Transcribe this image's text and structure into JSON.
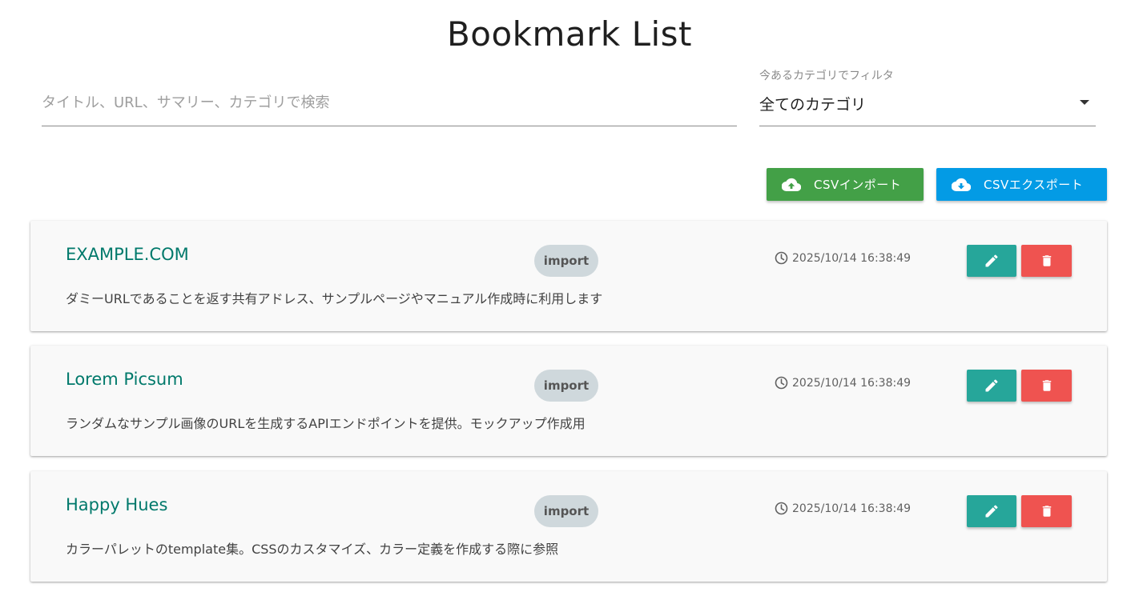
{
  "page": {
    "title": "Bookmark List"
  },
  "search": {
    "placeholder": "タイトル、URL、サマリー、カテゴリで検索",
    "value": ""
  },
  "filter": {
    "label": "今あるカテゴリでフィルタ",
    "selected": "全てのカテゴリ"
  },
  "toolbar": {
    "import_label": "CSVインポート",
    "export_label": "CSVエクスポート",
    "import_icon": "cloud-upload-icon",
    "export_icon": "cloud-download-icon"
  },
  "bookmarks": [
    {
      "title": "EXAMPLE.COM",
      "category": "import",
      "timestamp": "2025/10/14 16:38:49",
      "summary": "ダミーURLであることを返す共有アドレス、サンプルページやマニュアル作成時に利用します"
    },
    {
      "title": "Lorem Picsum",
      "category": "import",
      "timestamp": "2025/10/14 16:38:49",
      "summary": "ランダムなサンプル画像のURLを生成するAPIエンドポイントを提供。モックアップ作成用"
    },
    {
      "title": "Happy Hues",
      "category": "import",
      "timestamp": "2025/10/14 16:38:49",
      "summary": "カラーパレットのtemplate集。CSSのカスタマイズ、カラー定義を作成する際に参照"
    }
  ],
  "colors": {
    "title_link": "#00796b",
    "import_button": "#43a047",
    "export_button": "#039be5",
    "edit_button": "#26a69a",
    "delete_button": "#ef5350",
    "chip": "#cfd8dc"
  }
}
